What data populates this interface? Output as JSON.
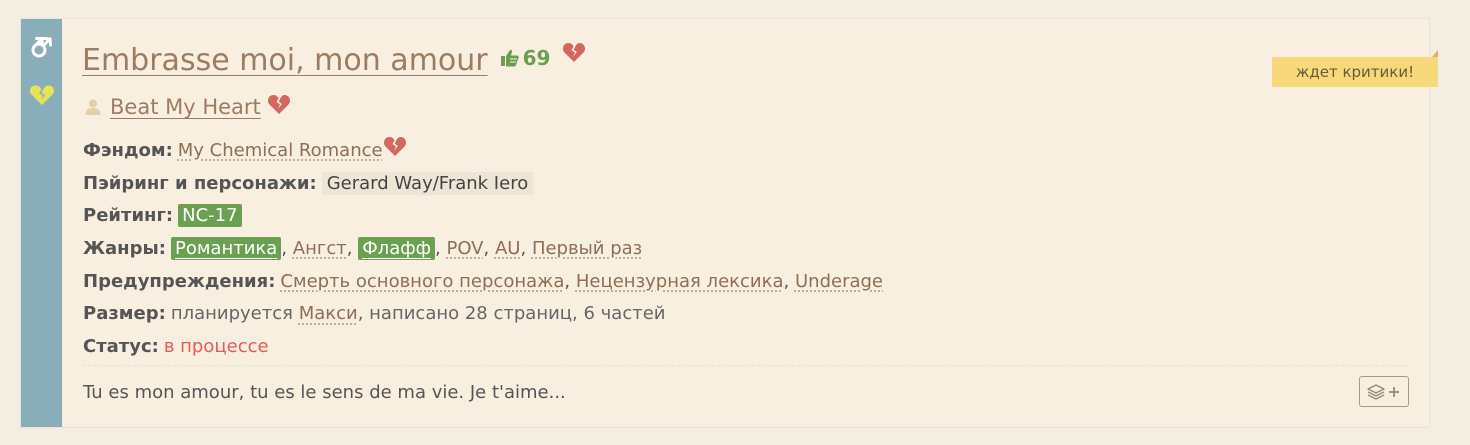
{
  "fanfic": {
    "title": "Embrasse moi, mon amour",
    "likes": "69",
    "author": "Beat My Heart",
    "badge": "ждет критики!",
    "description": "Tu es mon amour, tu es le sens de ma vie. Je t'aime...",
    "fandom": {
      "label": "Фэндом:",
      "value": "My Chemical Romance"
    },
    "pairing": {
      "label": "Пэйринг и персонажи:",
      "value": "Gerard Way/Frank Iero"
    },
    "rating": {
      "label": "Рейтинг:",
      "value": "NC-17"
    },
    "genres": {
      "label": "Жанры:",
      "items": [
        "Романтика",
        "Ангст",
        "Флафф",
        "POV",
        "AU",
        "Первый раз"
      ]
    },
    "warnings": {
      "label": "Предупреждения:",
      "items": [
        "Смерть основного персонажа",
        "Нецензурная лексика",
        "Underage"
      ]
    },
    "size": {
      "label": "Размер:",
      "prefix": "планируется",
      "size_link": "Макси",
      "suffix": ", написано 28 страниц, 6 частей"
    },
    "status": {
      "label": "Статус:",
      "value": "в процессе"
    },
    "separator": ","
  },
  "icons": {
    "direction": "male-male-icon",
    "side_heart": "broken-heart-yellow-icon",
    "like": "thumbs-up-icon",
    "heart": "broken-heart-icon",
    "author": "user-icon",
    "add_to_collection": "layers-plus-icon"
  },
  "colors": {
    "sidebar": "#88afb9",
    "card_bg": "#f8efe1",
    "link": "#9c7d63",
    "likes": "#6c9e51",
    "heart": "#d4675e",
    "green_tag": "#6ba053",
    "status": "#e55b55",
    "badge": "#f7d87a"
  }
}
